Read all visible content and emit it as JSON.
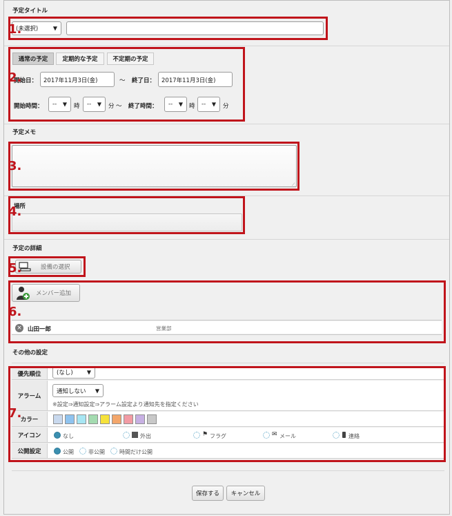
{
  "sections": {
    "title": "予定タイトル",
    "memo": "予定メモ",
    "place": "場所",
    "details": "予定の詳細",
    "other": "その他の設定"
  },
  "title_row": {
    "category_select": "(未選択)",
    "title_value": ""
  },
  "tabs": [
    {
      "label": "通常の予定",
      "active": true
    },
    {
      "label": "定期的な予定",
      "active": false
    },
    {
      "label": "不定期の予定",
      "active": false
    }
  ],
  "dates": {
    "start_label": "開始日：",
    "start_value": "2017年11月3日(金)",
    "tilde": "～",
    "end_label": "終了日：",
    "end_value": "2017年11月3日(金)"
  },
  "times": {
    "start_label": "開始時間：",
    "end_label": "終了時間：",
    "hour_value": "--",
    "minute_value": "--",
    "hour_unit": "時",
    "minute_unit": "分",
    "tilde": "～"
  },
  "memo_value": "",
  "place_value": "",
  "equipment_button": "設備の選択",
  "member_button": "メンバー追加",
  "members": [
    {
      "name": "山田一郎",
      "dept": "営業部"
    }
  ],
  "other": {
    "priority_label": "優先順位",
    "priority_value": "(なし)",
    "alarm_label": "アラーム",
    "alarm_value": "通知しない",
    "alarm_note": "※設定⇒通知設定⇒アラーム設定より通知先を指定ください",
    "color_label": "カラー",
    "colors": [
      "#c9d9ee",
      "#8fc3ef",
      "#a7e6f3",
      "#a4dbb0",
      "#f6e23a",
      "#f3a66b",
      "#f29ba4",
      "#c7b0e3",
      "#c8c8c8"
    ],
    "icon_label": "アイコン",
    "icons": [
      {
        "label": "なし",
        "selected": true,
        "icon": "none"
      },
      {
        "label": "外出",
        "selected": false,
        "icon": "building-icon"
      },
      {
        "label": "フラグ",
        "selected": false,
        "icon": "flag-icon"
      },
      {
        "label": "メール",
        "selected": false,
        "icon": "mail-icon"
      },
      {
        "label": "連絡",
        "selected": false,
        "icon": "phone-icon"
      }
    ],
    "public_label": "公開設定",
    "public_options": [
      {
        "label": "公開",
        "selected": true
      },
      {
        "label": "非公開",
        "selected": false
      },
      {
        "label": "時間だけ公開",
        "selected": false
      }
    ]
  },
  "footer": {
    "save": "保存する",
    "cancel": "キャンセル"
  },
  "markers": [
    "1.",
    "2.",
    "3.",
    "4.",
    "5.",
    "6.",
    "7."
  ],
  "marker_color": "#c0141b"
}
